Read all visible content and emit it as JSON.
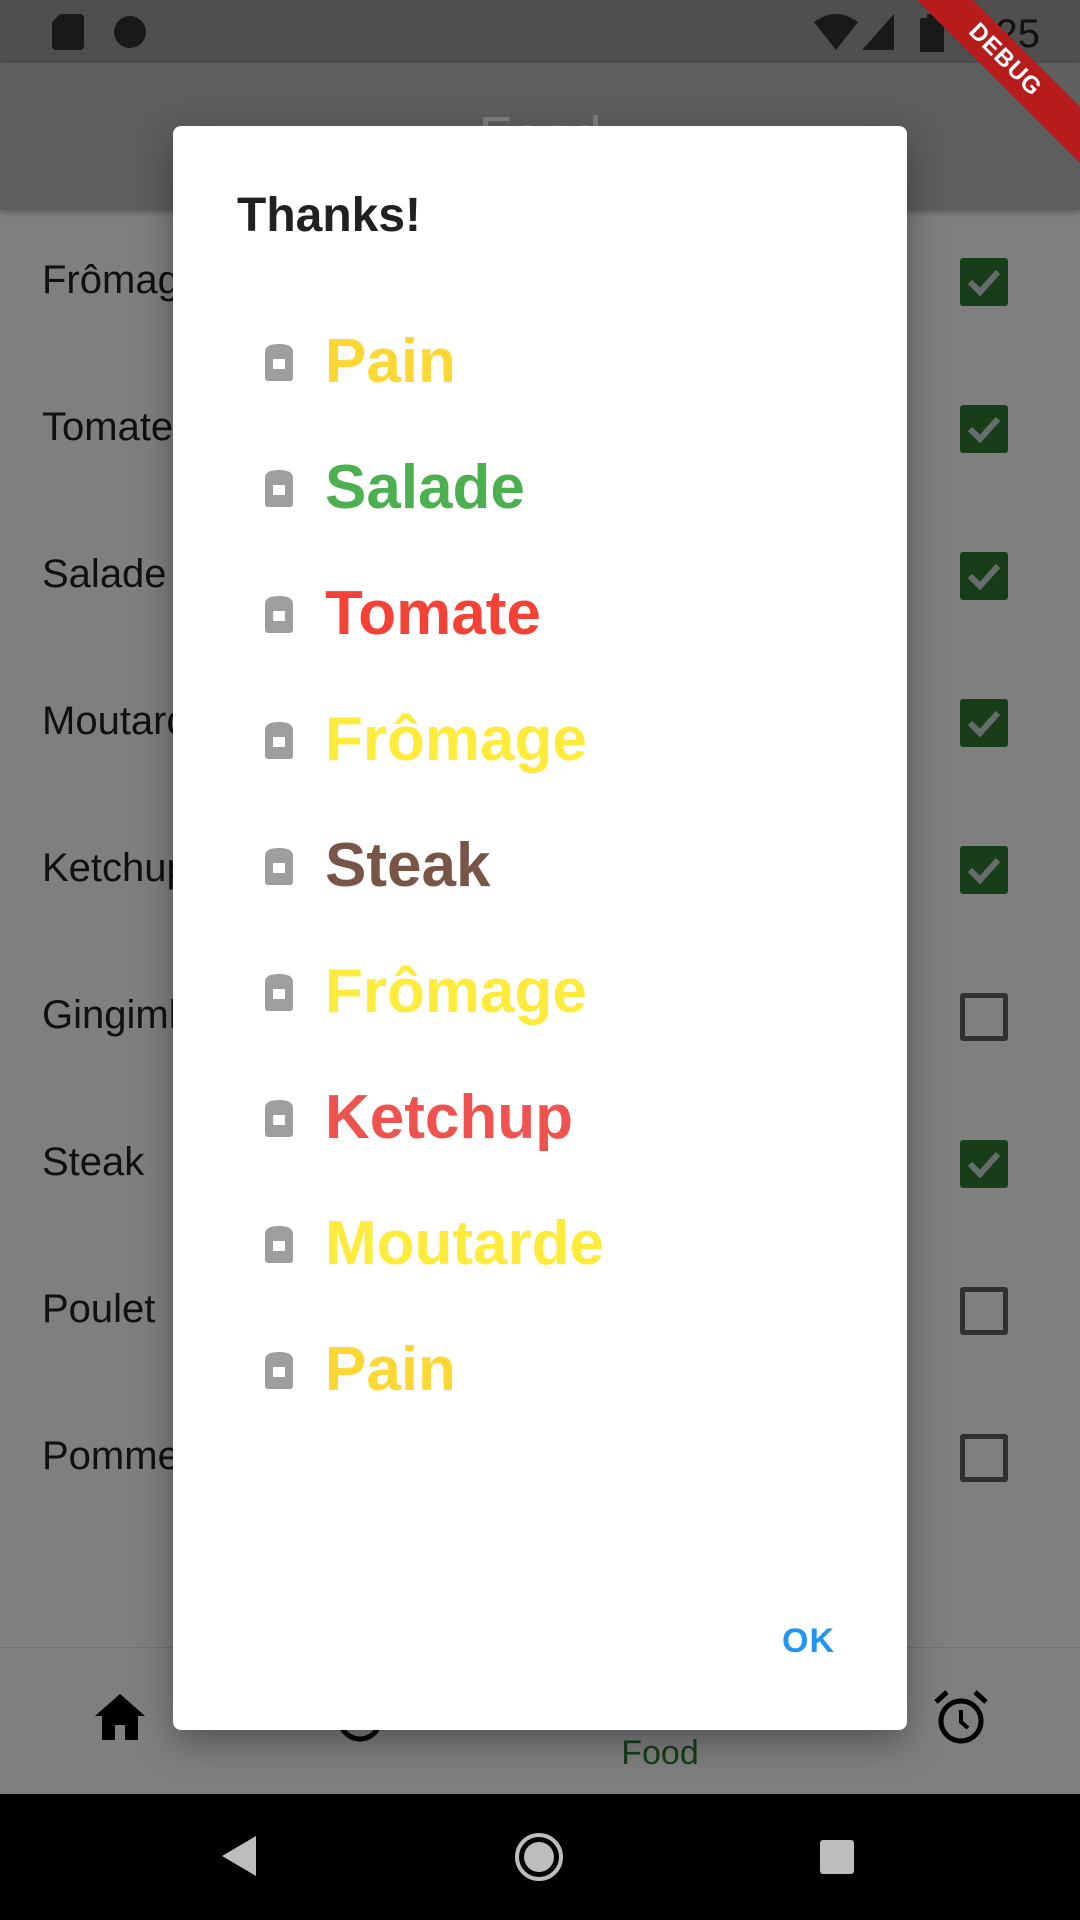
{
  "statusbar": {
    "time": "5:25"
  },
  "appbar": {
    "title": "Food"
  },
  "list": {
    "items": [
      {
        "label": "Frômage",
        "checked": true
      },
      {
        "label": "Tomate",
        "checked": true
      },
      {
        "label": "Salade",
        "checked": true
      },
      {
        "label": "Moutarde",
        "checked": true
      },
      {
        "label": "Ketchup",
        "checked": true
      },
      {
        "label": "Gingimbre",
        "checked": false
      },
      {
        "label": "Steak",
        "checked": true
      },
      {
        "label": "Poulet",
        "checked": false
      },
      {
        "label": "Pomme",
        "checked": false
      }
    ]
  },
  "bottomnav": {
    "active_label": "Food"
  },
  "dialog": {
    "title": "Thanks!",
    "items": [
      {
        "text": "Pain",
        "color": "#fdd835"
      },
      {
        "text": "Salade",
        "color": "#4caf50"
      },
      {
        "text": "Tomate",
        "color": "#f44336"
      },
      {
        "text": "Frômage",
        "color": "#ffeb3b"
      },
      {
        "text": "Steak",
        "color": "#795548"
      },
      {
        "text": "Frômage",
        "color": "#ffeb3b"
      },
      {
        "text": "Ketchup",
        "color": "#ef5350"
      },
      {
        "text": "Moutarde",
        "color": "#ffeb3b"
      },
      {
        "text": "Pain",
        "color": "#fdd835"
      }
    ],
    "ok_label": "OK"
  },
  "debug_banner": "DEBUG"
}
